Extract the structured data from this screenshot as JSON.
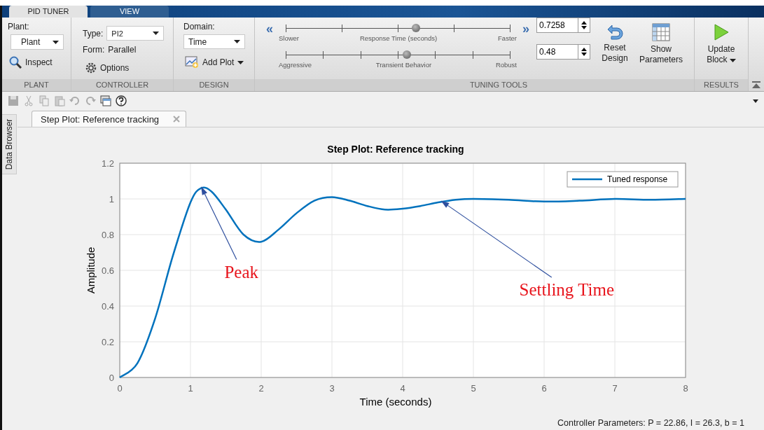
{
  "tabs": [
    {
      "label": "PID TUNER",
      "selected": true
    },
    {
      "label": "VIEW",
      "selected": false
    }
  ],
  "plant_section": {
    "plant_label": "Plant:",
    "plant_dropdown": "Plant",
    "inspect_button": "Inspect",
    "section_label": "PLANT"
  },
  "controller_section": {
    "type_label": "Type:",
    "type_dropdown": "PI2",
    "form_label": "Form:",
    "form_value": "Parallel",
    "options_button": "Options",
    "section_label": "CONTROLLER"
  },
  "design_section": {
    "domain_label": "Domain:",
    "domain_dropdown": "Time",
    "add_plot_button": "Add Plot",
    "section_label": "DESIGN"
  },
  "tuning_section": {
    "sliders": [
      {
        "left_label": "Slower",
        "center_label": "Response Time (seconds)",
        "right_label": "Faster",
        "level": 0.58,
        "value": "0.7258",
        "decrease_button": "«",
        "increase_button": "»"
      },
      {
        "left_label": "Aggressive",
        "center_label": "Transient Behavior",
        "right_label": "Robust",
        "level": 0.54,
        "value": "0.48"
      }
    ],
    "reset_button": "Reset Design",
    "show_parameters_button": "Show Parameters",
    "section_label": "TUNING TOOLS"
  },
  "results_section": {
    "update_button": "Update Block",
    "section_label": "RESULTS"
  },
  "side_panel": {
    "label": "Data Browser"
  },
  "document_tabs": [
    {
      "label": "Step Plot: Reference tracking",
      "selected": true
    }
  ],
  "plot": {
    "chart_data": {
      "type": "line",
      "title": "Step Plot: Reference tracking",
      "xlabel": "Time (seconds)",
      "ylabel": "Amplitude",
      "x": [
        0,
        0.25,
        0.5,
        0.75,
        1,
        1.15,
        1.3,
        1.5,
        1.75,
        2,
        2.25,
        2.5,
        2.75,
        3,
        3.25,
        3.5,
        3.75,
        4,
        4.25,
        4.5,
        4.75,
        5,
        5.5,
        6,
        6.5,
        7,
        7.5,
        8
      ],
      "series": [
        {
          "name": "Tuned response",
          "color": "#0072bd",
          "values": [
            0,
            0.08,
            0.33,
            0.68,
            0.98,
            1.06,
            1.04,
            0.94,
            0.8,
            0.76,
            0.83,
            0.92,
            0.99,
            1.01,
            0.99,
            0.96,
            0.94,
            0.945,
            0.96,
            0.98,
            0.995,
            1.0,
            0.995,
            0.985,
            0.99,
            1.0,
            0.995,
            1.0
          ]
        }
      ],
      "xlim": [
        0,
        8
      ],
      "ylim": [
        0,
        1.2
      ],
      "xticks": [
        0,
        1,
        2,
        3,
        4,
        5,
        6,
        7,
        8
      ],
      "yticks": [
        0,
        0.2,
        0.4,
        0.6,
        0.8,
        1,
        1.2
      ],
      "grid": true,
      "annotations": [
        "Peak",
        "Settling Time"
      ]
    }
  },
  "status_bar": {
    "text": "Controller Parameters: P = 22.86, I = 26.3, b = 1"
  }
}
